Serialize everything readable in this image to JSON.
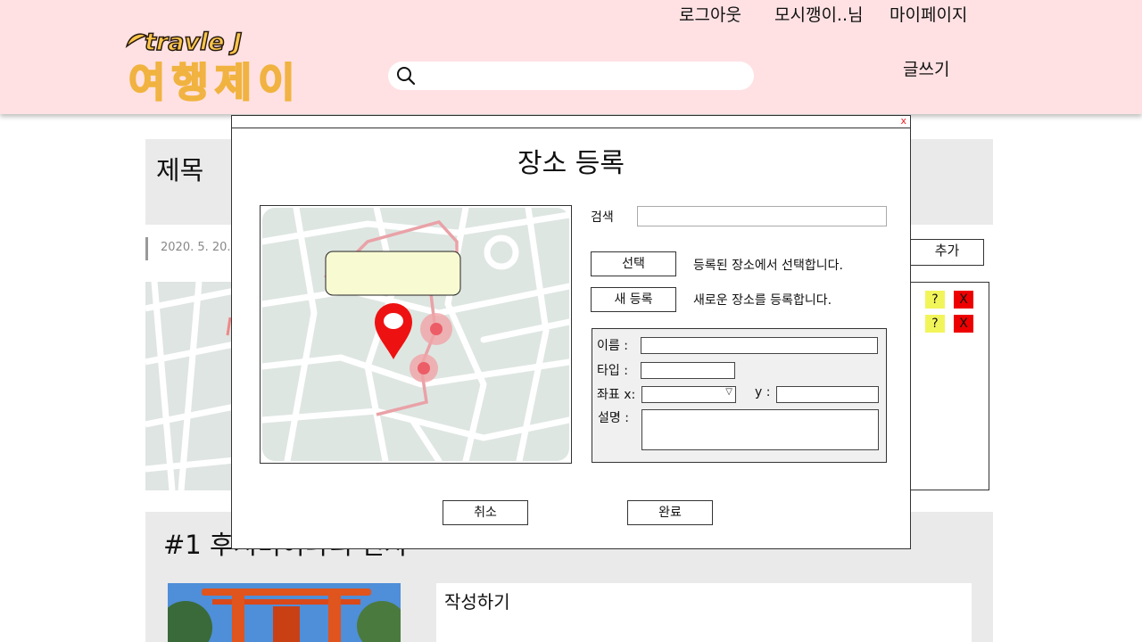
{
  "header": {
    "logout": "로그아웃",
    "user": "모시깽이..님",
    "mypage": "마이페이지",
    "write": "글쓰기",
    "logo_en": "travle J",
    "logo_ko": "여행제이",
    "search_placeholder": ""
  },
  "page": {
    "title": "제목",
    "date": "2020. 5. 20.",
    "add_button": "추가",
    "list_actions": [
      {
        "help": "?",
        "delete": "X"
      },
      {
        "help": "?",
        "delete": "X"
      }
    ],
    "day_title": "#1 후시미이나리 신사",
    "write_area_label": "작성하기"
  },
  "modal": {
    "close": "x",
    "title": "장소 등록",
    "search_label": "검색",
    "search_value": "",
    "select_button": "선택",
    "select_desc": "등록된 장소에서 선택합니다.",
    "new_button": "새 등록",
    "new_desc": "새로운 장소를 등록합니다.",
    "name_label": "이름 :",
    "type_label": "타입 :",
    "coord_x_label": "좌표 x:",
    "coord_y_label": "y :",
    "desc_label": "설명 :",
    "cancel_button": "취소",
    "done_button": "완료"
  },
  "colors": {
    "header_bg": "#ffe1e3",
    "panel_bg": "#eaeaea",
    "help_btn": "#f2f55a",
    "delete_btn": "#ee0000",
    "map_pin": "#ee1111",
    "map_tooltip": "#f8fbd2"
  }
}
